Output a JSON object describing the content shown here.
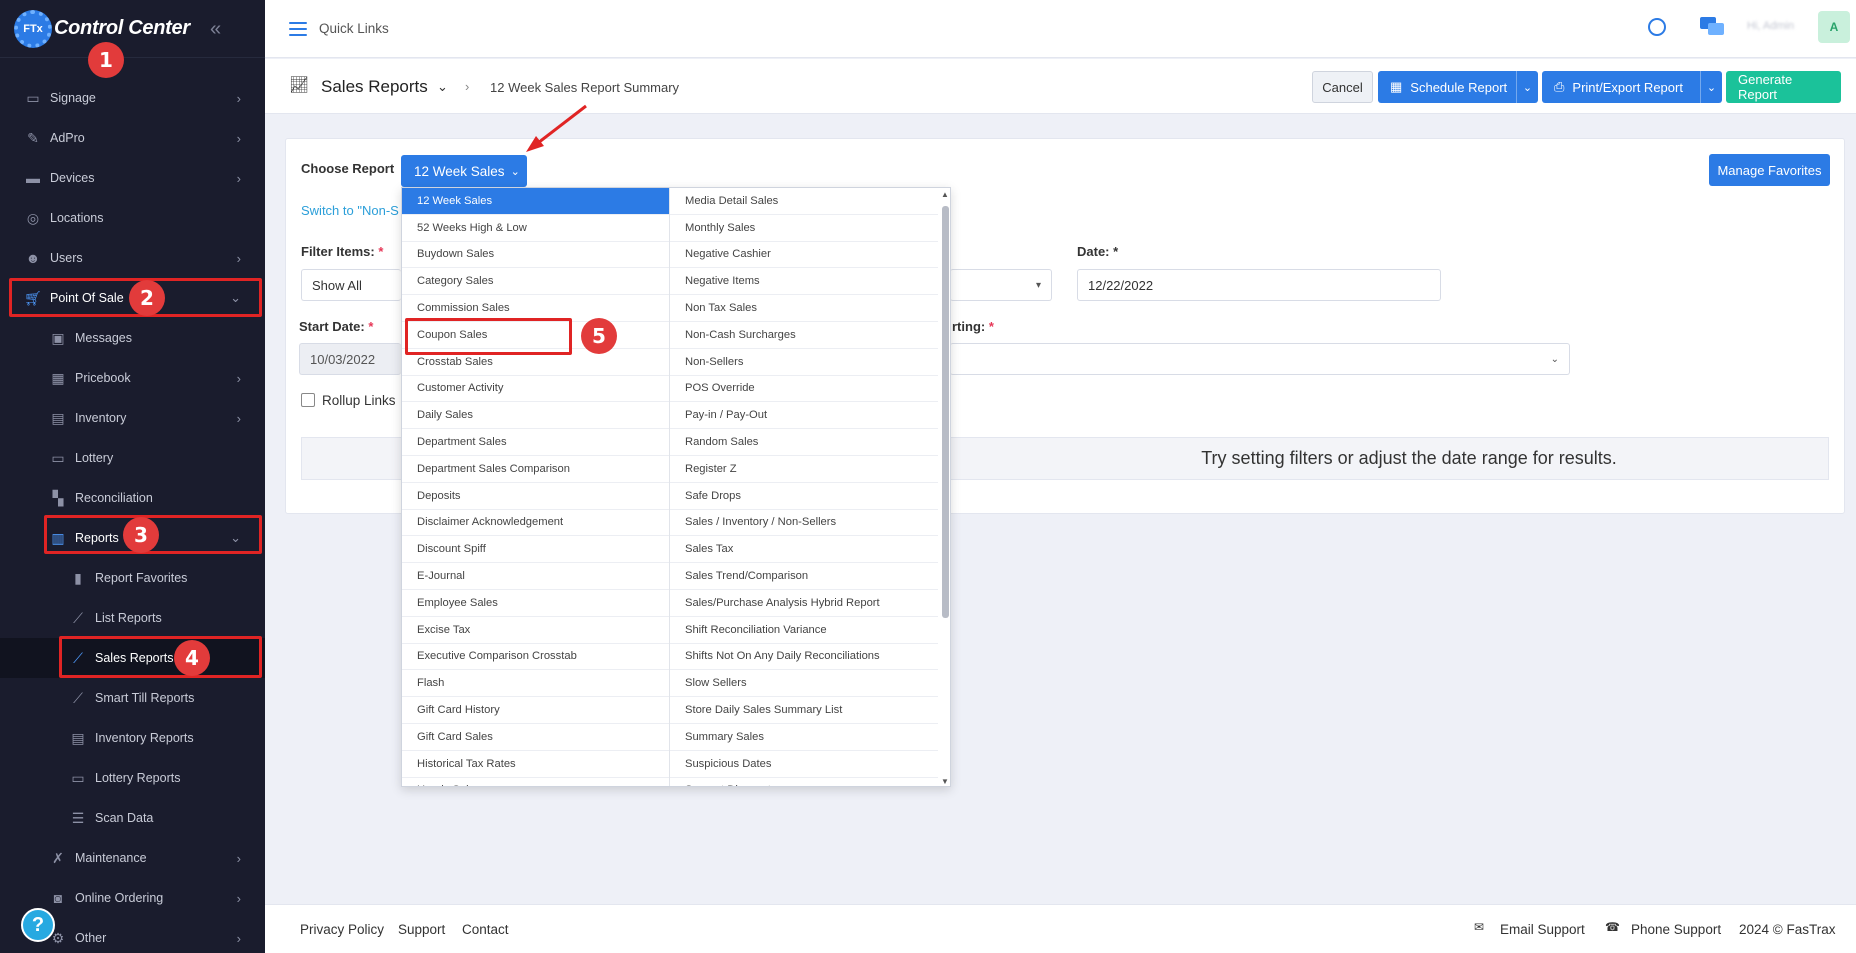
{
  "sidebar": {
    "brand_badge": "FTx",
    "brand_name": "Control Center",
    "items": [
      {
        "label": "Signage",
        "icon": "monitor-icon"
      },
      {
        "label": "AdPro",
        "icon": "pen-icon"
      },
      {
        "label": "Devices",
        "icon": "devices-icon"
      },
      {
        "label": "Locations",
        "icon": "location-pin-icon"
      },
      {
        "label": "Users",
        "icon": "users-icon"
      },
      {
        "label": "Point Of Sale",
        "icon": "cart-icon"
      },
      {
        "label": "Messages",
        "icon": "message-icon"
      },
      {
        "label": "Pricebook",
        "icon": "calculator-icon"
      },
      {
        "label": "Inventory",
        "icon": "inventory-icon"
      },
      {
        "label": "Lottery",
        "icon": "ticket-icon"
      },
      {
        "label": "Reconciliation",
        "icon": "grid-icon"
      },
      {
        "label": "Reports",
        "icon": "bar-chart-icon"
      },
      {
        "label": "Report Favorites",
        "icon": "bookmark-icon"
      },
      {
        "label": "List Reports",
        "icon": "line-chart-icon"
      },
      {
        "label": "Sales Reports",
        "icon": "line-chart-icon"
      },
      {
        "label": "Smart Till Reports",
        "icon": "line-chart-icon"
      },
      {
        "label": "Inventory Reports",
        "icon": "inventory-icon"
      },
      {
        "label": "Lottery Reports",
        "icon": "ticket-icon"
      },
      {
        "label": "Scan Data",
        "icon": "list-icon"
      },
      {
        "label": "Maintenance",
        "icon": "wrench-icon"
      },
      {
        "label": "Online Ordering",
        "icon": "bag-icon"
      },
      {
        "label": "Other",
        "icon": "gear-icon"
      }
    ],
    "help": "?"
  },
  "annotations": [
    "1",
    "2",
    "3",
    "4",
    "5"
  ],
  "topbar": {
    "quick_links": "Quick Links",
    "user_name": "Hi, Admin",
    "avatar_initial": "A"
  },
  "header": {
    "title": "Sales Reports",
    "breadcrumb_current": "12 Week Sales Report Summary",
    "cancel": "Cancel",
    "schedule": "Schedule Report",
    "print_export": "Print/Export Report",
    "generate": "Generate Report"
  },
  "form": {
    "choose_report_label": "Choose Report",
    "choose_report_value": "12 Week Sales",
    "switch_link": "Switch to \"Non-S",
    "manage_favorites": "Manage Favorites",
    "filter_items_label": "Filter Items:",
    "filter_items_value": "Show All",
    "date_label": "Date:",
    "date_value": "12/22/2022",
    "start_date_label": "Start Date:",
    "start_date_value": "10/03/2022",
    "sorting_label": "rting:",
    "required_mark": "*",
    "rollup_links": "Rollup Links",
    "empty_message": "Try setting filters or adjust the date range for results."
  },
  "dropdown": {
    "selected": "12 Week Sales",
    "col1": [
      "12 Week Sales",
      "52 Weeks High & Low",
      "Buydown Sales",
      "Category Sales",
      "Commission Sales",
      "Coupon Sales",
      "Crosstab Sales",
      "Customer Activity",
      "Daily Sales",
      "Department Sales",
      "Department Sales Comparison",
      "Deposits",
      "Disclaimer Acknowledgement",
      "Discount Spiff",
      "E-Journal",
      "Employee Sales",
      "Excise Tax",
      "Executive Comparison Crosstab",
      "Flash",
      "Gift Card History",
      "Gift Card Sales",
      "Historical Tax Rates",
      "Hourly Sales"
    ],
    "col2": [
      "Media Detail Sales",
      "Monthly Sales",
      "Negative Cashier",
      "Negative Items",
      "Non Tax Sales",
      "Non-Cash Surcharges",
      "Non-Sellers",
      "POS Override",
      "Pay-in / Pay-Out",
      "Random Sales",
      "Register Z",
      "Safe Drops",
      "Sales / Inventory / Non-Sellers",
      "Sales Tax",
      "Sales Trend/Comparison",
      "Sales/Purchase Analysis Hybrid Report",
      "Shift Reconciliation Variance",
      "Shifts Not On Any Daily Reconciliations",
      "Slow Sellers",
      "Store Daily Sales Summary List",
      "Summary Sales",
      "Suspicious Dates",
      "Support Discounts"
    ]
  },
  "footer": {
    "privacy": "Privacy Policy",
    "support": "Support",
    "contact": "Contact",
    "email_support": "Email Support",
    "phone_support": "Phone Support",
    "copyright": "2024 © FasTrax"
  }
}
